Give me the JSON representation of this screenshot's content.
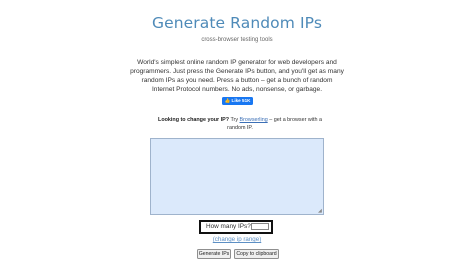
{
  "header": {
    "title": "Generate Random IPs",
    "subtitle": "cross-browser testing tools"
  },
  "intro": {
    "text": "World's simplest online random IP generator for web developers and programmers. Just press the Generate IPs button, and you'll get as many random IPs as you need. Press a button – get a bunch of random Internet Protocol numbers. No ads, nonsense, or garbage."
  },
  "social": {
    "like_label": "👍 Like 51K",
    "brand_color": "#1877f2"
  },
  "change_ip": {
    "bold_text": "Looking to change your IP?",
    "try_text": "Try",
    "link_text": "Browserling",
    "tail_text": "– get a browser with a random IP."
  },
  "output": {
    "value": ""
  },
  "count": {
    "label": "How many IPs?",
    "value": ""
  },
  "range_link": "(change ip range)",
  "buttons": {
    "generate": "Generate IPs",
    "copy": "Copy to clipboard"
  },
  "colors": {
    "title": "#4e8ab8",
    "textarea_bg": "#dbe9fb",
    "link": "#3b6fb6"
  }
}
